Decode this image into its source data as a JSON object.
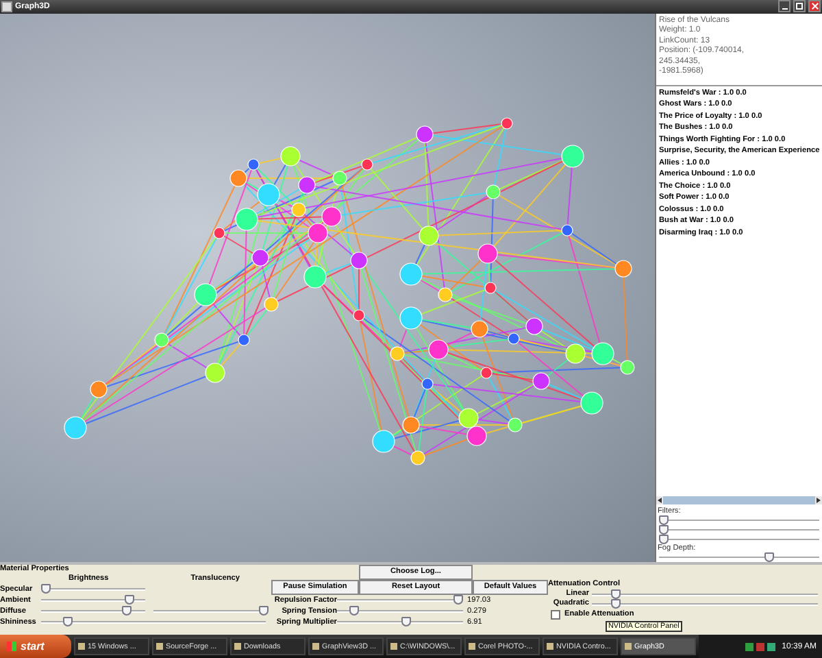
{
  "window": {
    "title": "Graph3D"
  },
  "node_info": {
    "lines": [
      "Rise of the Vulcans",
      "Weight: 1.0",
      "LinkCount: 13",
      "Position: (-109.740014,",
      "245.34435,",
      "-1981.5968)"
    ]
  },
  "link_list": {
    "items": [
      "Rumsfeld's War : 1.0 0.0",
      "Ghost Wars : 1.0 0.0",
      "The Price of Loyalty : 1.0 0.0",
      "The Bushes : 1.0 0.0",
      "Things Worth Fighting For : 1.0 0.0",
      "Surprise, Security, the American Experience",
      "Allies : 1.0 0.0",
      "America Unbound : 1.0 0.0",
      "The Choice : 1.0 0.0",
      "Soft Power : 1.0 0.0",
      "Colossus : 1.0 0.0",
      "Bush at War : 1.0 0.0",
      "Disarming Iraq : 1.0 0.0"
    ]
  },
  "filters": {
    "label": "Filters:",
    "sliders": [
      {
        "level": 0.0
      },
      {
        "level": 0.0
      },
      {
        "level": 0.0
      }
    ]
  },
  "fog": {
    "label": "Fog Depth:",
    "level": 0.7
  },
  "material": {
    "title": "Material Properties",
    "brightness_label": "Brightness",
    "translucency_label": "Translucency",
    "rows": [
      {
        "label": "Specular",
        "level": 0.0
      },
      {
        "label": "Ambient",
        "level": 0.88
      },
      {
        "label": "Diffuse",
        "level": 0.85
      },
      {
        "label": "Shininess",
        "level": 0.1
      }
    ],
    "translucency": {
      "level": 1.0
    }
  },
  "buttons": {
    "choose_log": "Choose Log...",
    "pause": "Pause Simulation",
    "reset": "Reset Layout",
    "defaults": "Default Values"
  },
  "simulation": [
    {
      "label": "Repulsion Factor",
      "level": 1.0,
      "reading": "197.03"
    },
    {
      "label": "Spring Tension",
      "level": 0.1,
      "reading": "0.279"
    },
    {
      "label": "Spring Multiplier",
      "level": 0.55,
      "reading": "6.91"
    }
  ],
  "attenuation": {
    "title": "Attenuation Control",
    "sliders": [
      {
        "label": "Linear",
        "level": 0.09
      },
      {
        "label": "Quadratic",
        "level": 0.09
      }
    ],
    "enable": {
      "label": "Enable Attenuation",
      "checked": false
    }
  },
  "tooltip": "NVIDIA Control Panel",
  "taskbar": {
    "start": "start",
    "items": [
      {
        "label": "15 Windows ...",
        "selected": false
      },
      {
        "label": "SourceForge ...",
        "selected": false
      },
      {
        "label": "Downloads",
        "selected": false
      },
      {
        "label": "GraphView3D ...",
        "selected": false
      },
      {
        "label": "C:\\WINDOWS\\...",
        "selected": false
      },
      {
        "label": "Corel PHOTO-...",
        "selected": false
      },
      {
        "label": "NVIDIA Contro...",
        "selected": false
      },
      {
        "label": "Graph3D",
        "selected": true
      }
    ],
    "clock": "10:39 AM"
  }
}
